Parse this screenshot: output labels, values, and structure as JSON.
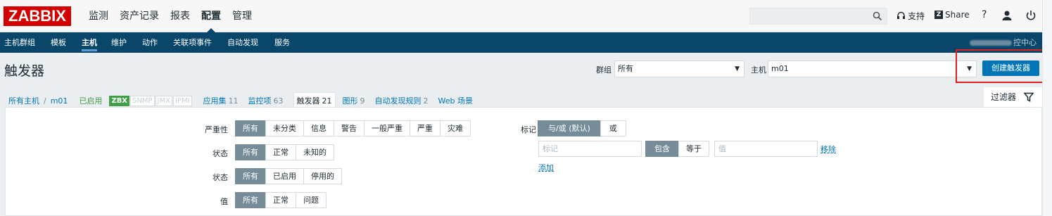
{
  "header": {
    "logo": "ZABBIX",
    "menu": [
      "监测",
      "资产记录",
      "报表",
      "配置",
      "管理"
    ],
    "active_menu": "配置",
    "support": "支持",
    "share": "Share",
    "help": "?"
  },
  "subnav": {
    "items": [
      "主机群组",
      "模板",
      "主机",
      "维护",
      "动作",
      "关联项事件",
      "自动发现",
      "服务"
    ],
    "active": "主机",
    "right_text": "控中心"
  },
  "page": {
    "title": "触发器",
    "group_label": "群组",
    "group_value": "所有",
    "host_label": "主机",
    "host_value": "m01",
    "create_button": "创建触发器"
  },
  "breadcrumb": {
    "all_hosts": "所有主机",
    "sep": "/",
    "host": "m01",
    "status": "已启用",
    "badges": [
      "ZBX",
      "SNMP",
      "JMX",
      "IPMI"
    ],
    "tabs": [
      {
        "label": "应用集",
        "count": "11"
      },
      {
        "label": "监控项",
        "count": "63"
      },
      {
        "label": "触发器",
        "count": "21"
      },
      {
        "label": "图形",
        "count": "9"
      },
      {
        "label": "自动发现规则",
        "count": "2"
      },
      {
        "label": "Web 场景",
        "count": ""
      }
    ],
    "active_tab": "触发器"
  },
  "filter": {
    "tab_label": "过滤器",
    "severity_label": "严重性",
    "severity_options": [
      "所有",
      "未分类",
      "信息",
      "警告",
      "一般严重",
      "严重",
      "灾难"
    ],
    "state_label": "状态",
    "state_options": [
      "所有",
      "正常",
      "未知的"
    ],
    "status_label": "状态",
    "status_options": [
      "所有",
      "已启用",
      "停用的"
    ],
    "value_label": "值",
    "value_options": [
      "所有",
      "正常",
      "问题"
    ],
    "tags_label": "标记",
    "tags_mode_options": [
      "与/或 (默认)",
      "或"
    ],
    "tag_placeholder": "标记",
    "tag_operator_options": [
      "包含",
      "等于"
    ],
    "tag_value_placeholder": "值",
    "remove_link": "移除",
    "add_link": "添加"
  },
  "colors": {
    "brand": "#d40000",
    "nav": "#0a466a",
    "primary": "#0275b8",
    "selected": "#768d99",
    "enabled": "#429e47",
    "highlight": "#e01f1f"
  }
}
